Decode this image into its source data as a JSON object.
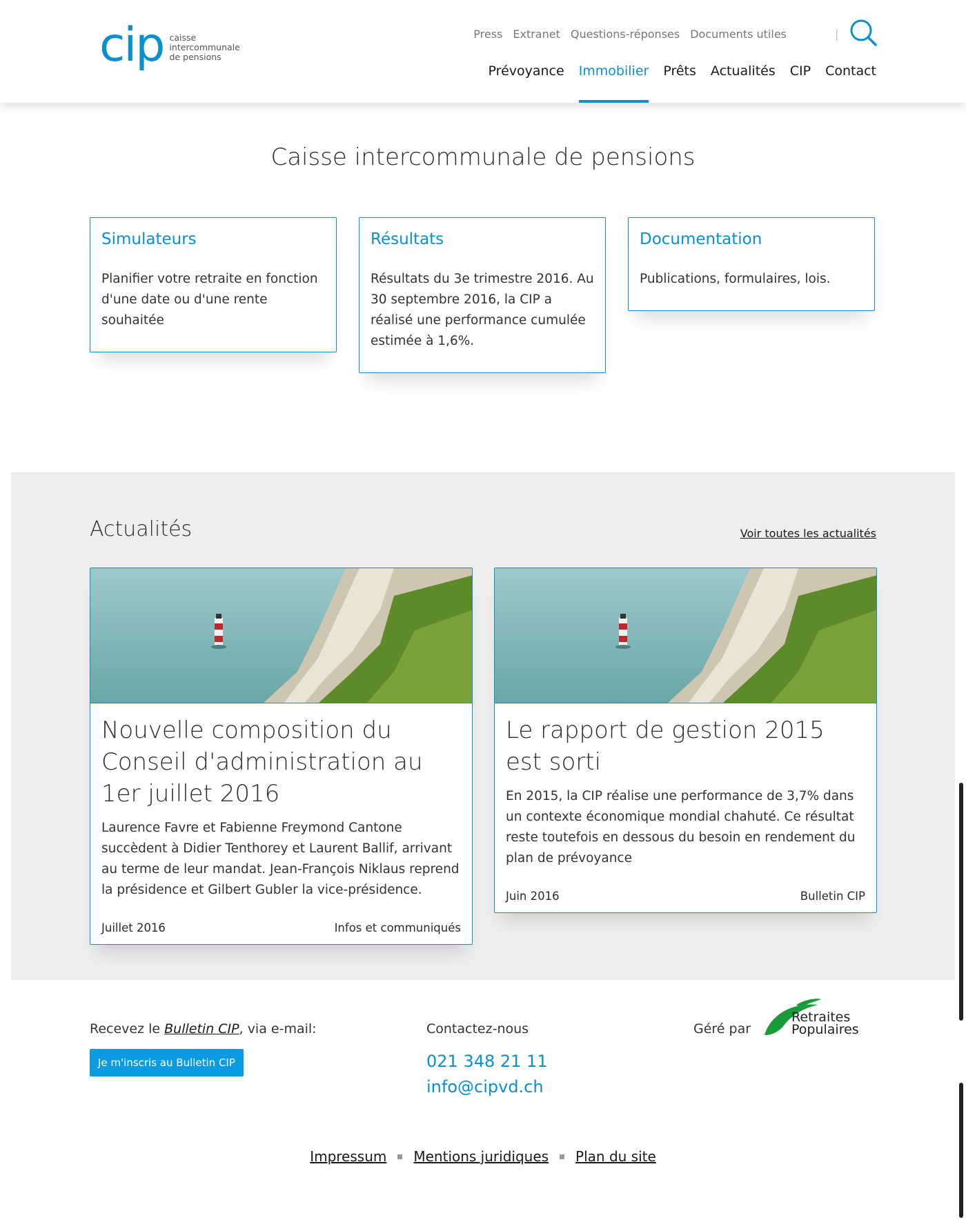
{
  "header": {
    "logo": {
      "mark": "cip",
      "line1": "caisse",
      "line2": "intercommunale",
      "line3": "de pensions"
    },
    "util_nav": [
      "Press",
      "Extranet",
      "Questions-réponses",
      "Documents utiles"
    ],
    "separator": "|",
    "main_nav": [
      {
        "label": "Prévoyance",
        "active": false
      },
      {
        "label": "Immobilier",
        "active": true
      },
      {
        "label": "Prêts",
        "active": false
      },
      {
        "label": "Actualités",
        "active": false
      },
      {
        "label": "CIP",
        "active": false
      },
      {
        "label": "Contact",
        "active": false
      }
    ],
    "search_icon": "search-icon"
  },
  "hero": {
    "title": "Caisse intercommunale de pensions",
    "cards": [
      {
        "title": "Simulateurs",
        "text": "Planifier votre retraite en fonction d'une date ou d'une rente souhaitée"
      },
      {
        "title": "Résultats",
        "text": "Résultats du 3e trimestre 2016. Au 30 septembre 2016, la CIP a réalisé une performance cumulée estimée à 1,6%."
      },
      {
        "title": "Documentation",
        "text": "Publications, formulaires, lois."
      }
    ]
  },
  "news": {
    "title": "Actualités",
    "see_all": "Voir toutes les actualités",
    "items": [
      {
        "headline": "Nouvelle composition du Conseil d'administration au 1er juillet 2016",
        "summary": "Laurence Favre et Fabienne Freymond Cantone succèdent à Didier Tenthorey et Laurent Ballif, arrivant au terme de leur mandat. Jean-François Niklaus reprend la présidence et Gilbert Gubler la vice-présidence.",
        "date": "Juillet 2016",
        "category": "Infos et communiqués"
      },
      {
        "headline": "Le rapport de gestion 2015 est sorti",
        "summary": "En 2015, la CIP réalise une performance de 3,7% dans un contexte économique mondial chahuté. Ce résultat reste toutefois en dessous du besoin en rendement du plan de prévoyance",
        "date": "Juin 2016",
        "category": "Bulletin CIP"
      }
    ]
  },
  "footer": {
    "newsletter_prefix": "Recevez le ",
    "newsletter_name": "Bulletin CIP",
    "newsletter_suffix": ", via e-mail:",
    "newsletter_button": "Je m'inscris au Bulletin CIP",
    "contact_label": "Contactez-nous",
    "phone": "021 348 21 11",
    "email": "info@cipvd.ch",
    "managed_by": "Géré par",
    "partner_line1": "Retraites",
    "partner_line2": "Populaires",
    "links": [
      "Impressum",
      "Mentions juridiques",
      "Plan du site"
    ]
  },
  "colors": {
    "accent": "#0a8fd1",
    "news_bg": "#eeeeee",
    "partner_green": "#1a9b3a"
  }
}
